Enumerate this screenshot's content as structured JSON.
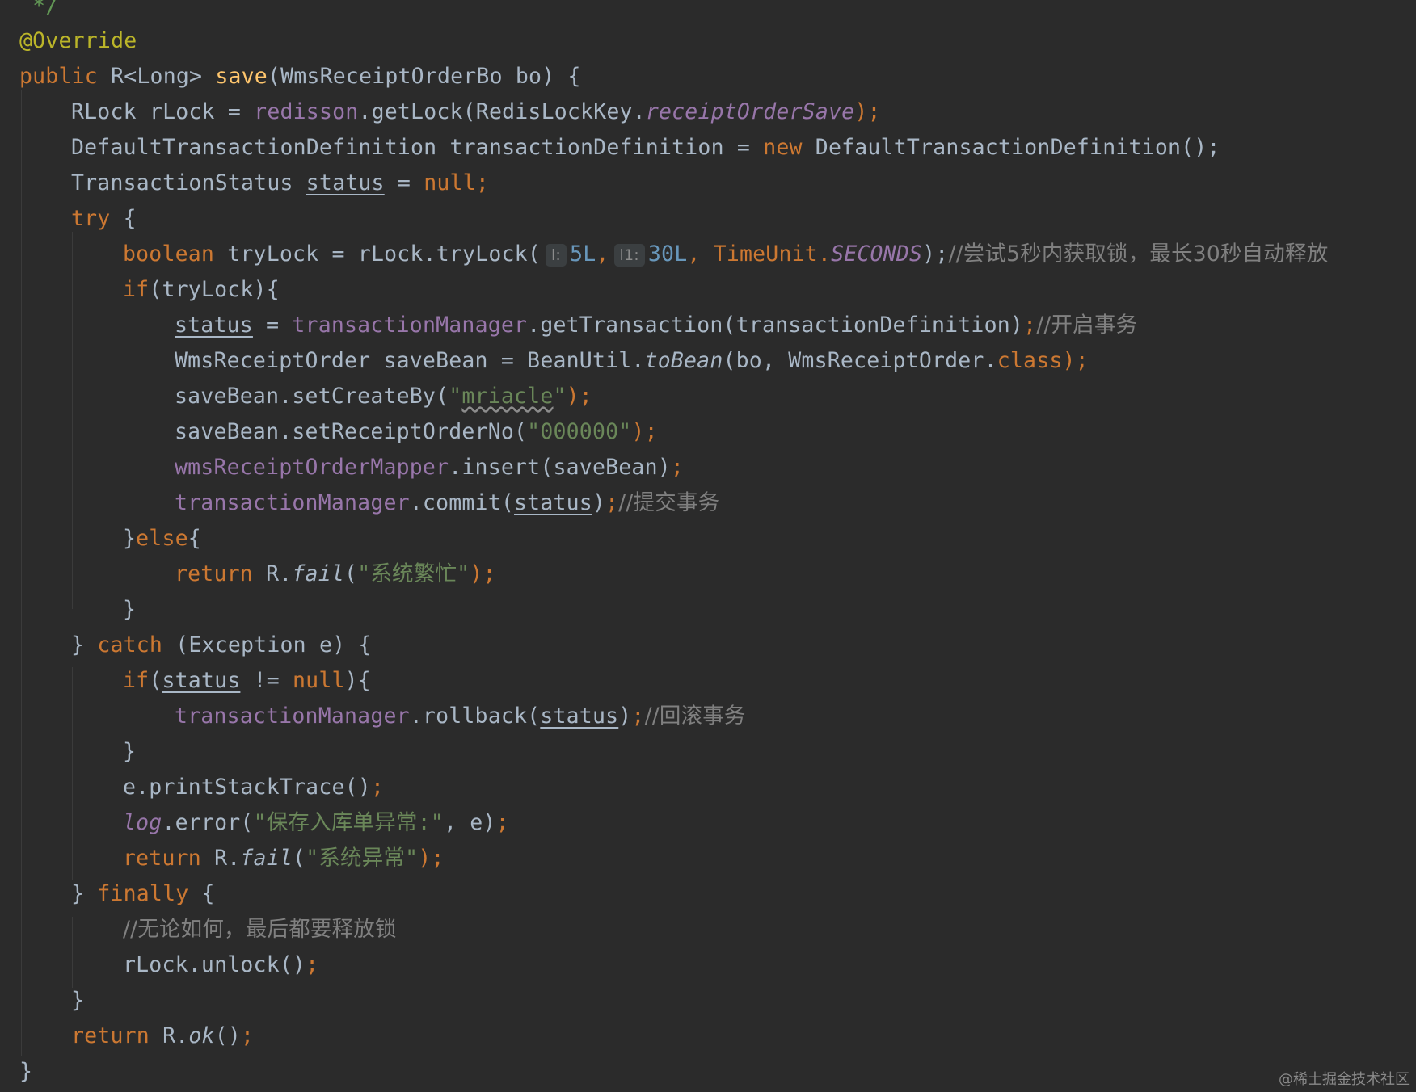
{
  "theme": {
    "background": "#2b2b2b",
    "default_text": "#a9b7c6",
    "keyword": "#cc7832",
    "method_decl": "#ffc66d",
    "annotation": "#bbb529",
    "field": "#9876aa",
    "number": "#6897bb",
    "string": "#6a8759",
    "comment": "#808080"
  },
  "code": {
    "l0": {
      "a": " */"
    },
    "l1": {
      "a": "@Override"
    },
    "l2": {
      "a": "public",
      "b": " R<Long> ",
      "c": "save",
      "d": "(WmsReceiptOrderBo bo) {"
    },
    "l3": {
      "a": "RLock rLock = ",
      "b": "redisson",
      "c": ".getLock(RedisLockKey.",
      "d": "receiptOrderSave",
      "e": ");"
    },
    "l4": {
      "a": "DefaultTransactionDefinition transactionDefinition = ",
      "b": "new",
      "c": " DefaultTransactionDefinition();"
    },
    "l5": {
      "a": "TransactionStatus ",
      "b": "status",
      "c": " = ",
      "d": "null",
      "e": ";"
    },
    "l6": {
      "a": "try",
      "b": " {"
    },
    "l7": {
      "a": "boolean",
      "b": " tryLock = rLock.tryLock(",
      "h1": "l:",
      "n1": "5L",
      "c": ",",
      "h2": "l1:",
      "n2": "30L",
      "d": ", TimeUnit.",
      "e": "SECONDS",
      "f": ");",
      "g": "//尝试5秒内获取锁，最长30秒自动释放"
    },
    "l8": {
      "a": "if",
      "b": "(tryLock){"
    },
    "l9": {
      "a": "status",
      "b": " = ",
      "c": "transactionManager",
      "d": ".getTransaction(transactionDefinition)",
      "e": ";",
      "f": "//开启事务"
    },
    "l10": {
      "a": "WmsReceiptOrder saveBean = BeanUtil.",
      "b": "toBean",
      "c": "(bo, WmsReceiptOrder.",
      "d": "class",
      "e": ");"
    },
    "l11": {
      "a": "saveBean.setCreateBy(",
      "b": "\"",
      "c": "mriacle",
      "d": "\"",
      "e": ");"
    },
    "l12": {
      "a": "saveBean.setReceiptOrderNo(",
      "b": "\"000000\"",
      "c": ");"
    },
    "l13": {
      "a": "wmsReceiptOrderMapper",
      "b": ".insert(saveBean)",
      "c": ";"
    },
    "l14": {
      "a": "transactionManager",
      "b": ".commit(",
      "c": "status",
      "d": ")",
      "e": ";",
      "f": "//提交事务"
    },
    "l15": {
      "a": "}",
      "b": "else",
      "c": "{"
    },
    "l16": {
      "a": "return",
      "b": " R.",
      "c": "fail",
      "d": "(",
      "e": "\"系统繁忙\"",
      "f": ");"
    },
    "l17": {
      "a": "}"
    },
    "l18": {
      "a": "} ",
      "b": "catch",
      "c": " (Exception e) {"
    },
    "l19": {
      "a": "if",
      "b": "(",
      "c": "status",
      "d": " != ",
      "e": "null",
      "f": "){"
    },
    "l20": {
      "a": "transactionManager",
      "b": ".rollback(",
      "c": "status",
      "d": ")",
      "e": ";",
      "f": "//回滚事务"
    },
    "l21": {
      "a": "}"
    },
    "l22": {
      "a": "e.printStackTrace()",
      "b": ";"
    },
    "l23": {
      "a": "log",
      "b": ".error(",
      "c": "\"保存入库单异常:\"",
      "d": ", e)",
      "e": ";"
    },
    "l24": {
      "a": "return",
      "b": " R.",
      "c": "fail",
      "d": "(",
      "e": "\"系统异常\"",
      "f": ");"
    },
    "l25": {
      "a": "} ",
      "b": "finally",
      "c": " {"
    },
    "l26": {
      "a": "//无论如何，最后都要释放锁"
    },
    "l27": {
      "a": "rLock.unlock()",
      "b": ";"
    },
    "l28": {
      "a": "}"
    },
    "l29": {
      "a": "return",
      "b": " R.",
      "c": "ok",
      "d": "()",
      "e": ";"
    },
    "l30": {
      "a": "}"
    }
  },
  "watermark": "@稀土掘金技术社区"
}
